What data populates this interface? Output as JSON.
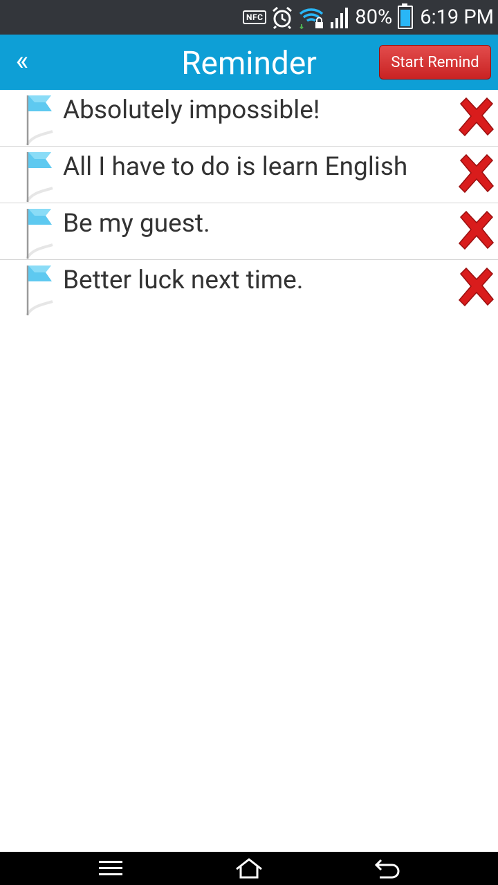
{
  "status_bar": {
    "nfc": "NFC",
    "icons": [
      "nfc-icon",
      "alarm-icon",
      "wifi-lock-icon",
      "signal-icon",
      "battery-icon"
    ],
    "battery_percent": "80%",
    "time": "6:19 PM"
  },
  "header": {
    "back_icon": "«",
    "title": "Reminder",
    "start_button": "Start Remind",
    "color": "#0e9fd6"
  },
  "reminders": [
    {
      "text": "Absolutely impossible!"
    },
    {
      "text": "All I have to do is learn English"
    },
    {
      "text": "Be my guest."
    },
    {
      "text": "Better luck next time."
    }
  ],
  "navigation": {
    "icons": [
      "menu-icon",
      "home-icon",
      "back-icon"
    ]
  },
  "colors": {
    "status_bar": "#33363b",
    "accent": "#0e9fd6",
    "button_red": "#c92323",
    "delete_red": "#d91c1c",
    "flag_blue": "#5ec9f0"
  }
}
